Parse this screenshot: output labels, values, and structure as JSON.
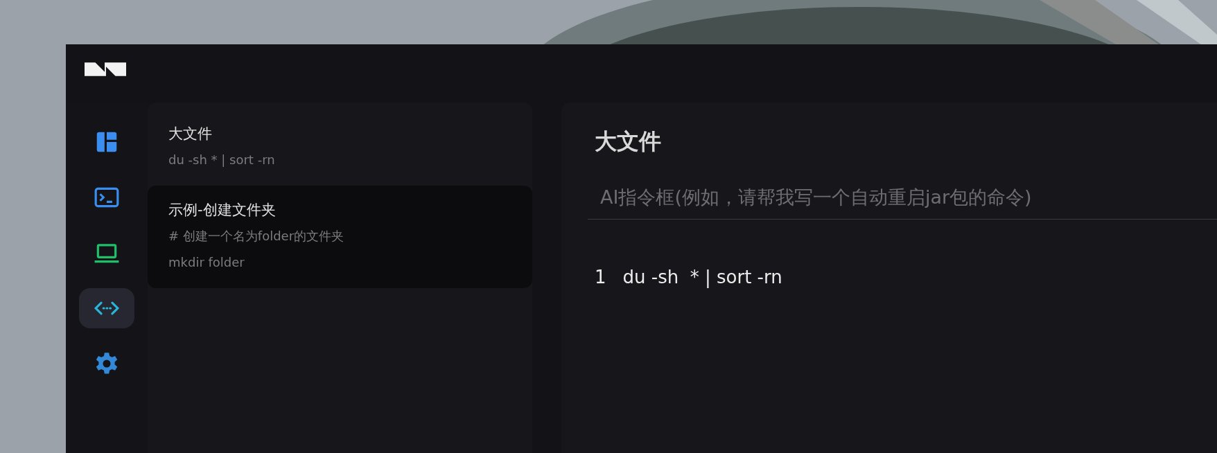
{
  "nav": [
    {
      "kind": "dashboard",
      "selected": false
    },
    {
      "kind": "terminal",
      "selected": false
    },
    {
      "kind": "laptop",
      "selected": false
    },
    {
      "kind": "code",
      "selected": true
    },
    {
      "kind": "settings",
      "selected": false
    }
  ],
  "snippets": [
    {
      "title": "大文件",
      "lines": [
        "du -sh  * | sort -rn"
      ],
      "hovered": false
    },
    {
      "title": "示例-创建文件夹",
      "lines": [
        "# 创建一个名为folder的文件夹",
        "mkdir folder"
      ],
      "hovered": true
    }
  ],
  "editor": {
    "title": "大文件",
    "ai_prompt": {
      "placeholder": "AI指令框(例如，请帮我写一个自动重启jar包的命令)"
    },
    "code_lines": [
      {
        "number": "1",
        "text": "du -sh  * | sort -rn"
      }
    ]
  }
}
